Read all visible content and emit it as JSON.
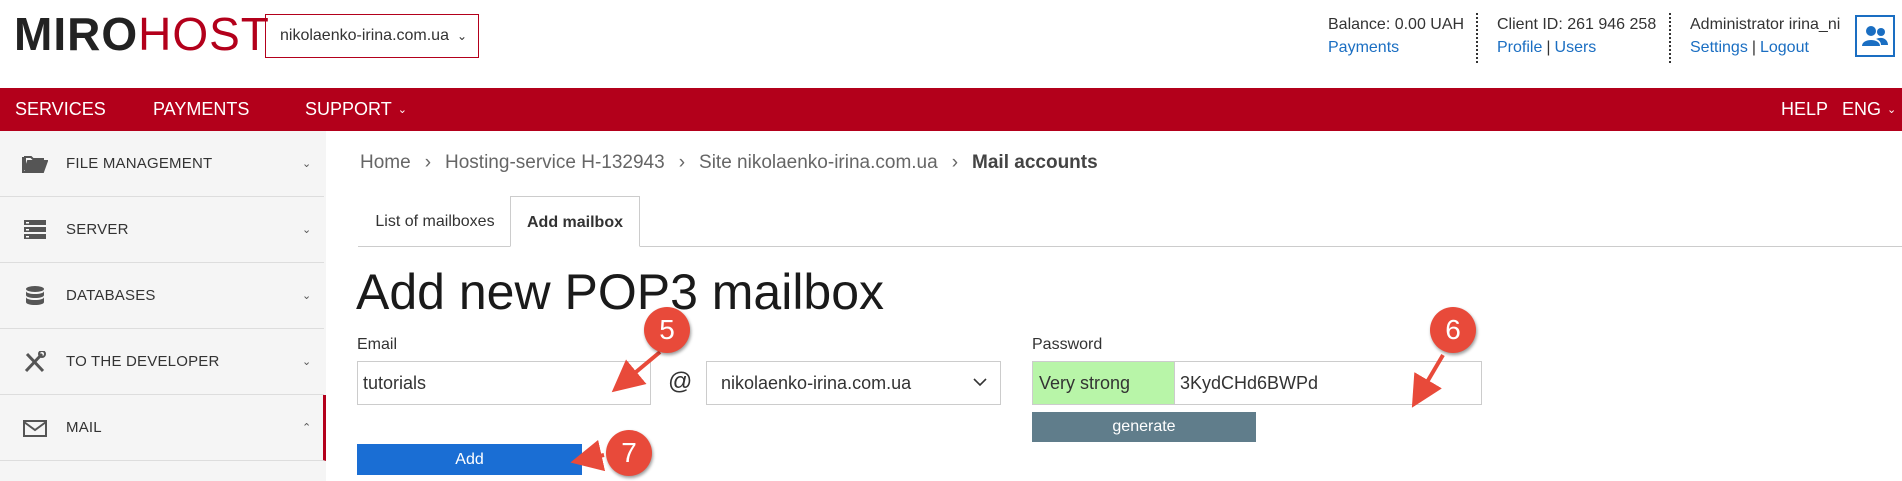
{
  "header": {
    "logo_part1": "MIRO",
    "logo_part2": "HOST",
    "site_selector": "nikolaenko-irina.com.ua",
    "balance": {
      "text": "Balance: 0.00 UAH",
      "link": "Payments"
    },
    "client": {
      "text": "Client ID: 261 946 258",
      "profile": "Profile",
      "separator": "|",
      "users": "Users"
    },
    "admin": {
      "text": "Administrator irina_ni",
      "settings": "Settings",
      "separator": "|",
      "logout": "Logout"
    }
  },
  "nav": {
    "services": "SERVICES",
    "payments": "PAYMENTS",
    "support": "SUPPORT",
    "help": "HELP",
    "language": "ENG"
  },
  "sidebar": {
    "items": [
      {
        "label": "FILE MANAGEMENT",
        "icon": "folder-icon"
      },
      {
        "label": "SERVER",
        "icon": "server-icon"
      },
      {
        "label": "DATABASES",
        "icon": "database-icon"
      },
      {
        "label": "TO THE DEVELOPER",
        "icon": "tools-icon"
      },
      {
        "label": "MAIL",
        "icon": "mail-icon"
      }
    ]
  },
  "breadcrumb": {
    "home": "Home",
    "hosting": "Hosting-service H-132943",
    "site": "Site nikolaenko-irina.com.ua",
    "current": "Mail accounts"
  },
  "tabs": {
    "list": "List of mailboxes",
    "add": "Add mailbox"
  },
  "form": {
    "title": "Add new POP3 mailbox",
    "email_label": "Email",
    "email_value": "tutorials",
    "at": "@",
    "domain_value": "nikolaenko-irina.com.ua",
    "password_label": "Password",
    "strength": "Very strong",
    "password_value": "3KydCHd6BWPd",
    "generate": "generate",
    "add": "Add"
  },
  "annotations": {
    "step5": "5",
    "step6": "6",
    "step7": "7"
  },
  "colors": {
    "brand_red": "#b3001b",
    "link_blue": "#1a6ec2",
    "add_button": "#1a6ed4",
    "generate_button": "#607d8b",
    "strength_green": "#b8f5a8",
    "annotation_red": "#e84a3a"
  }
}
